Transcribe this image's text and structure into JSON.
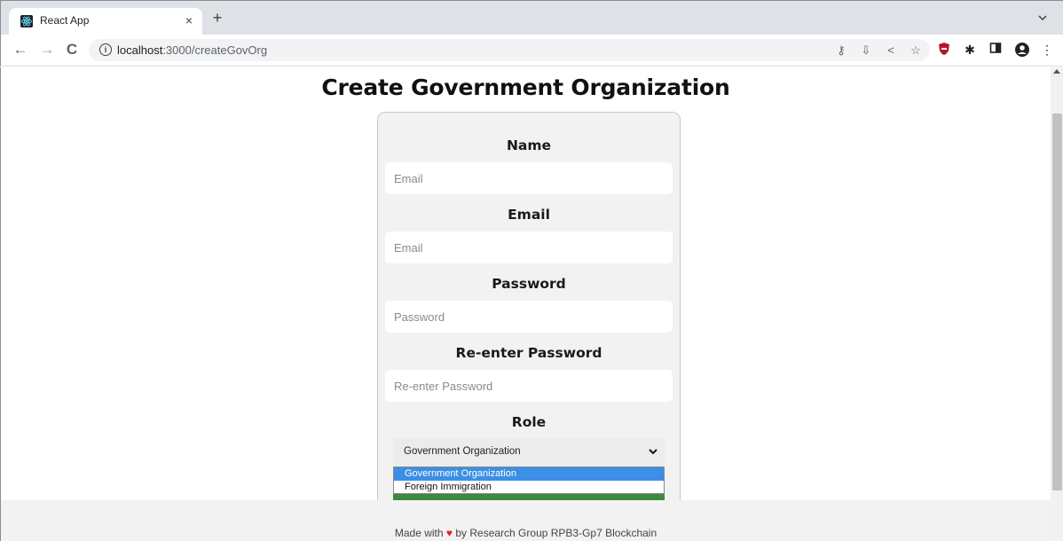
{
  "browser": {
    "tab_title": "React App",
    "tab_close": "×",
    "new_tab": "+",
    "url_host": "localhost",
    "url_path": ":3000/createGovOrg",
    "info_icon": "i",
    "icons": {
      "back": "arrow-left-icon",
      "forward": "arrow-right-icon",
      "reload": "reload-icon",
      "key": "key-icon",
      "install": "install-icon",
      "share": "share-icon",
      "star": "star-icon",
      "shield": "shield-extension-icon",
      "puzzle": "puzzle-extension-icon",
      "sidepanel": "side-panel-icon",
      "profile": "profile-icon",
      "menu": "kebab-menu-icon"
    }
  },
  "page": {
    "title": "Create Government Organization",
    "form": {
      "name": {
        "label": "Name",
        "placeholder": "Email"
      },
      "email": {
        "label": "Email",
        "placeholder": "Email"
      },
      "password": {
        "label": "Password",
        "placeholder": "Password"
      },
      "reenter": {
        "label": "Re-enter Password",
        "placeholder": "Re-enter Password"
      },
      "role": {
        "label": "Role",
        "selected": "Government Organization",
        "options": [
          "Government Organization",
          "Foreign Immigration"
        ]
      }
    },
    "footer": {
      "prefix": "Made with",
      "heart": "♥",
      "suffix": "by Research Group RPB3-Gp7 Blockchain"
    }
  },
  "colors": {
    "accent_option": "#3b8fe4",
    "submit_green": "#3d8a3d",
    "heart": "#e0222b"
  }
}
